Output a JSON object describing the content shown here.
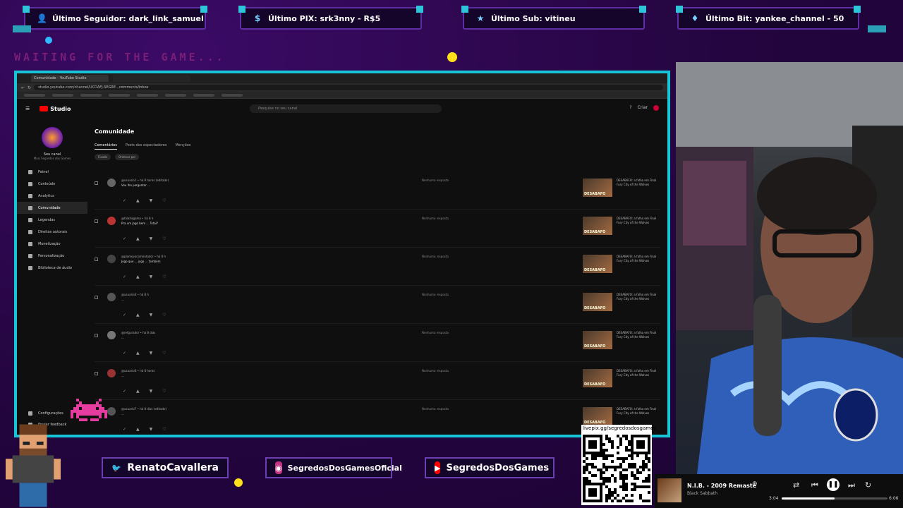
{
  "overlay": {
    "badges": [
      {
        "label": "Último Seguidor: dark_link_samuel",
        "icon": "user-icon"
      },
      {
        "label": "Último PIX: srk3nny - R$5",
        "icon": "dollar-icon"
      },
      {
        "label": "Último Sub: vitineu",
        "icon": "star-icon"
      },
      {
        "label": "Último Bit: yankee_channel - 50",
        "icon": "diamond-icon"
      }
    ],
    "waiting": "WAITING FOR THE GAME...",
    "socials": [
      {
        "label": "RenatoCavallera",
        "icon": "twitter-icon",
        "color": "#1da1f2"
      },
      {
        "label": "SegredosDosGamesOficial",
        "icon": "instagram-icon",
        "color": "#c13584"
      },
      {
        "label": "SegredosDosGames",
        "icon": "youtube-icon",
        "color": "#ff0000"
      }
    ],
    "qr_url": "livepix.gg/segredosdosgames"
  },
  "browser": {
    "tab_title": "Comunidade - YouTube Studio",
    "url": "studio.youtube.com/channel/UCDAFJ-SEGRE...comments/inbox",
    "studio_label": "Studio",
    "search_placeholder": "Pesquise no seu canal",
    "create_label": "Criar"
  },
  "sidebar": {
    "channel_name": "Seu canal",
    "channel_sub": "Mais Segredos dos Games",
    "items": [
      {
        "label": "Painel"
      },
      {
        "label": "Conteúdo"
      },
      {
        "label": "Analytics"
      },
      {
        "label": "Comunidade",
        "active": true
      },
      {
        "label": "Legendas"
      },
      {
        "label": "Direitos autorais"
      },
      {
        "label": "Monetização"
      },
      {
        "label": "Personalização"
      },
      {
        "label": "Biblioteca de áudio"
      }
    ],
    "footer": [
      "Configurações",
      "Enviar feedback"
    ]
  },
  "main": {
    "title": "Comunidade",
    "tabs": [
      "Comentários",
      "Posts dos espectadores",
      "Menções"
    ],
    "filters": [
      "Fixado",
      "Ordenar por"
    ],
    "comments": [
      {
        "author": "@usuario1 • há 8 horas (editado)",
        "text": "Vou lhe perguntar ...",
        "status": "Nenhuma resposta",
        "video_title": "DESABAFO: a falha em Final Fury City of the Wolves"
      },
      {
        "author": "@fulahagoma • há 8 h",
        "text": "Pra um jogo bem ... Total?",
        "status": "Nenhuma resposta",
        "video_title": "DESABAFO: a falha em Final Fury City of the Wolves"
      },
      {
        "author": "@plamovocomentador • há 8 h",
        "text": "Jogo que ... jogo ... também",
        "status": "Nenhuma resposta",
        "video_title": "DESABAFO: a falha em Final Fury City of the Wolves"
      },
      {
        "author": "@usuario4 • há 8 h",
        "text": "...",
        "status": "Nenhuma resposta",
        "video_title": "DESABAFO: a falha em Final Fury City of the Wolves"
      },
      {
        "author": "@refgurador • há 8 dias",
        "text": "...",
        "status": "Nenhuma resposta",
        "video_title": "DESABAFO: a falha em Final Fury City of the Wolves"
      },
      {
        "author": "@usuario6 • há 8 horas",
        "text": "...",
        "status": "Nenhuma resposta",
        "video_title": "DESABAFO: a falha em Final Fury City of the Wolves"
      },
      {
        "author": "@usuario7 • há 8 dias (editado)",
        "text": "...",
        "status": "Nenhuma resposta",
        "video_title": "DESABAFO: a falha em Final Fury City of the Wolves"
      }
    ],
    "thumb_label": "DESABAFO"
  },
  "player": {
    "song": "N.I.B. - 2009 Remaste",
    "artist": "Black Sabbath",
    "elapsed": "3:04",
    "duration": "6:06",
    "progress": 0.5
  }
}
